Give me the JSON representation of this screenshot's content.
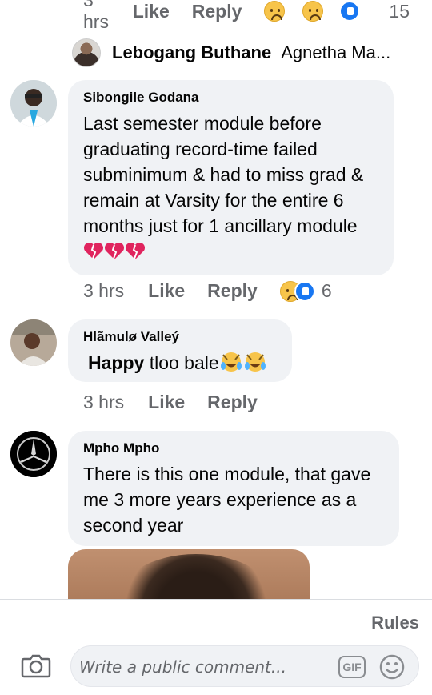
{
  "top_row": {
    "time": "3 hrs",
    "like": "Like",
    "reply": "Reply",
    "reaction_count": "15"
  },
  "reply_preview": {
    "name": "Lebogang Buthane",
    "snippet": "Agnetha Ma..."
  },
  "comments": [
    {
      "author": "Sibongile Godana",
      "text": "Last semester module before graduating record-time failed subminimum & had to miss grad & remain at Varsity for the entire 6 months just for 1 ancillary module",
      "time": "3 hrs",
      "like": "Like",
      "reply": "Reply",
      "reaction_count": "6",
      "emoji": "broken-heart-emoji"
    },
    {
      "author": "Hlãmulø Valleý",
      "text_bold": "Happy",
      "text": "tloo bale",
      "time": "3 hrs",
      "like": "Like",
      "reply": "Reply",
      "emoji": "laughing-crying-emoji"
    },
    {
      "author": "Mpho Mpho",
      "text": "There is this one module, that gave me 3 more years experience as a second year"
    }
  ],
  "footer": {
    "rules": "Rules",
    "composer_placeholder": "Write a public comment...",
    "gif_label": "GIF"
  },
  "colors": {
    "bubble_bg": "#f0f2f5",
    "secondary_text": "#65676b",
    "like_blue": "#1877f2"
  }
}
